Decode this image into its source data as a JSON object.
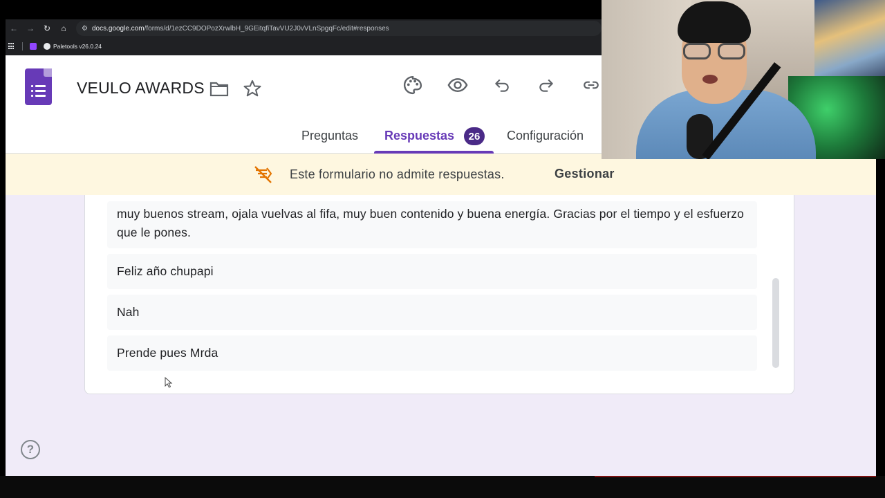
{
  "browser": {
    "url_host": "docs.google.com",
    "url_path": "/forms/d/1ezCC9DOPozXrwlbH_9GEitqfiTavVU2J0vVLnSpgqFc/edit#responses",
    "bookmark": "Paletools v26.0.24"
  },
  "form": {
    "title": "VEULO AWARDS",
    "header_icons": [
      "palette-icon",
      "eye-icon",
      "undo-icon",
      "redo-icon",
      "link-icon"
    ],
    "tabs": [
      {
        "label": "Preguntas",
        "active": false
      },
      {
        "label": "Respuestas",
        "active": true
      },
      {
        "label": "Configuración",
        "active": false
      }
    ],
    "response_count": "26",
    "accent_color": "#673ab7"
  },
  "notice": {
    "text": "Este formulario no admite respuestas.",
    "action": "Gestionar",
    "background": "#fef7e0"
  },
  "responses": [
    "muy buenos stream, ojala vuelvas al fifa, muy buen contenido y buena energía. Gracias por el tiempo y el esfuerzo que le pones.",
    "Feliz año chupapi",
    "Nah",
    "Prende pues Mrda"
  ],
  "help": "?"
}
